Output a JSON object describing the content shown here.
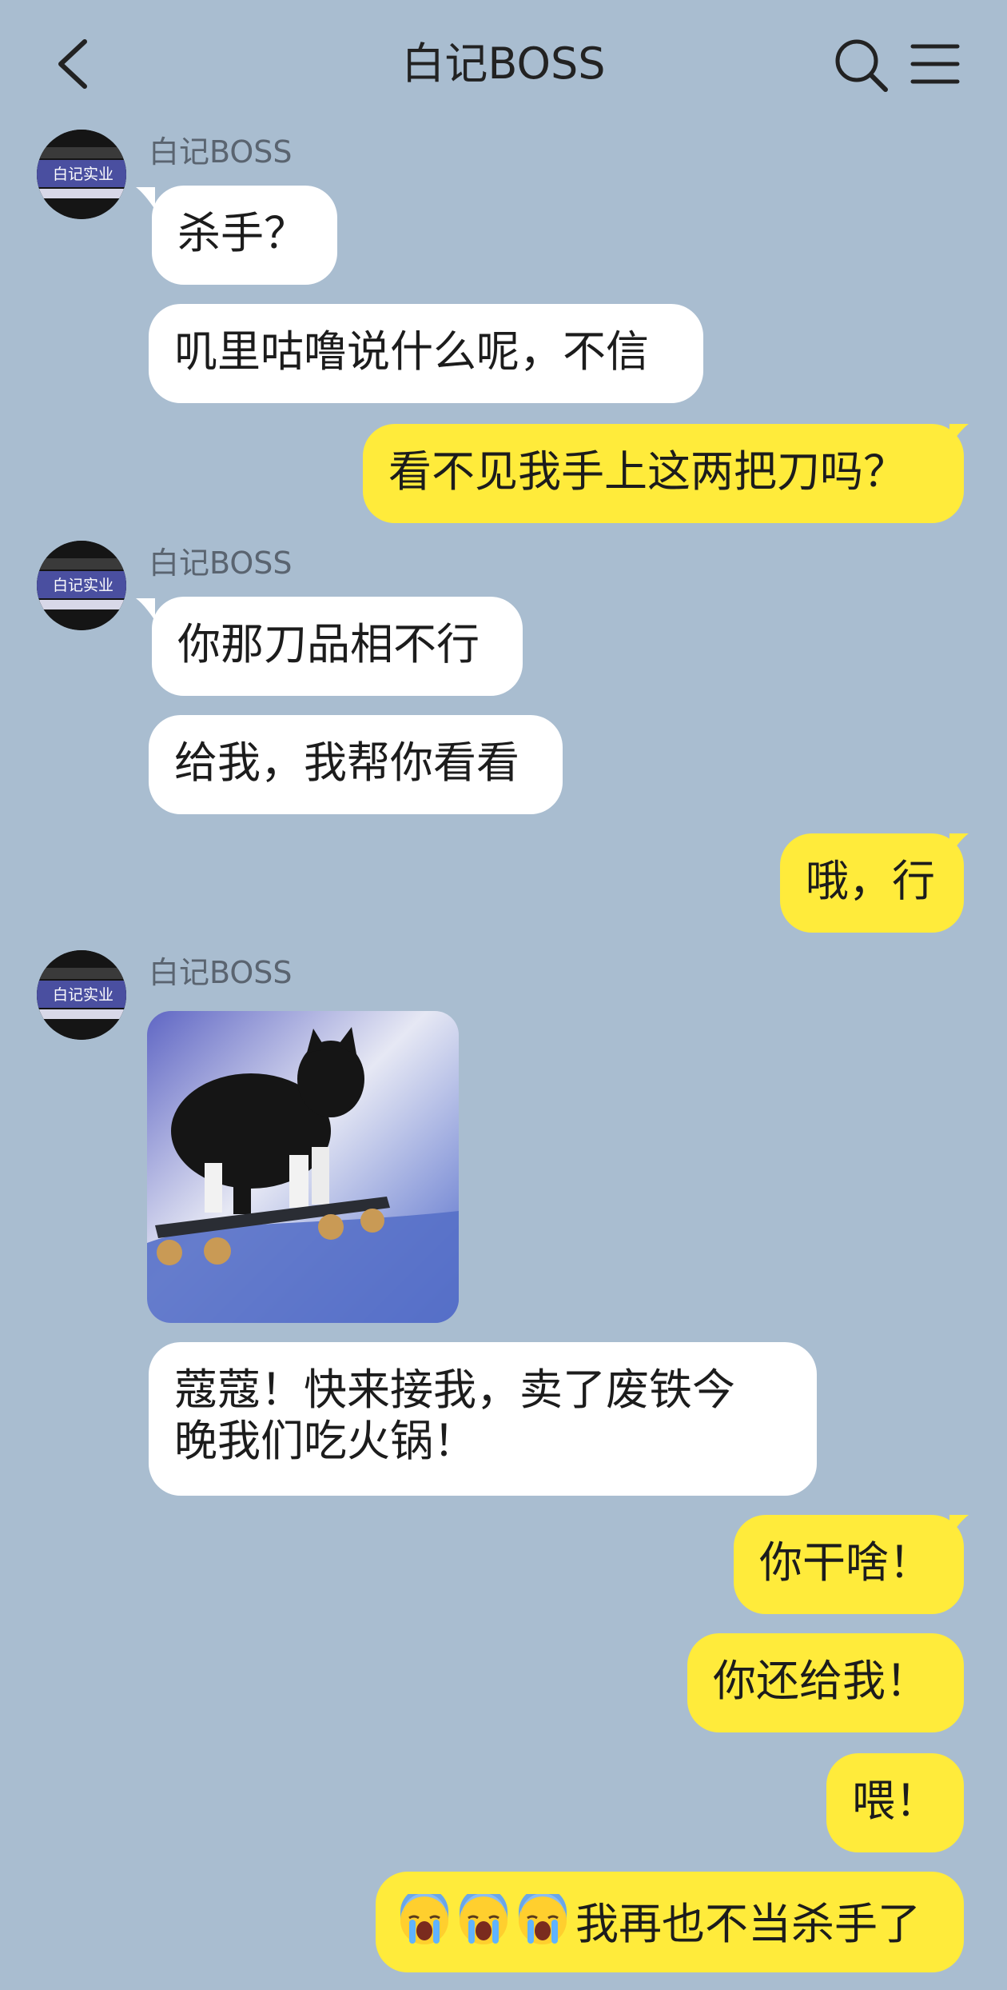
{
  "header": {
    "title": "白记BOSS"
  },
  "contact": {
    "name": "白记BOSS",
    "avatar_text": "白记实业"
  },
  "messages": [
    {
      "from": "them",
      "text": "杀手？"
    },
    {
      "from": "them",
      "text": "叽里咕噜说什么呢，不信"
    },
    {
      "from": "me",
      "text": "看不见我手上这两把刀吗？"
    },
    {
      "from": "them",
      "text": "你那刀品相不行"
    },
    {
      "from": "them",
      "text": "给我，我帮你看看"
    },
    {
      "from": "me",
      "text": "哦，行"
    },
    {
      "from": "them",
      "type": "sticker",
      "sticker": "cat-on-skateboard"
    },
    {
      "from": "them",
      "line1": "蔻蔻！快来接我，卖了废铁今",
      "line2": "晚我们吃火锅！"
    },
    {
      "from": "me",
      "text": "你干啥！"
    },
    {
      "from": "me",
      "text": "你还给我！"
    },
    {
      "from": "me",
      "text": "喂！"
    },
    {
      "from": "me",
      "emojis": [
        "crying-face",
        "crying-face",
        "crying-face"
      ],
      "text": "我再也不当杀手了"
    }
  ],
  "colors": {
    "background": "#a9bdd0",
    "incoming_bubble": "#ffffff",
    "outgoing_bubble": "#ffeb3b"
  }
}
